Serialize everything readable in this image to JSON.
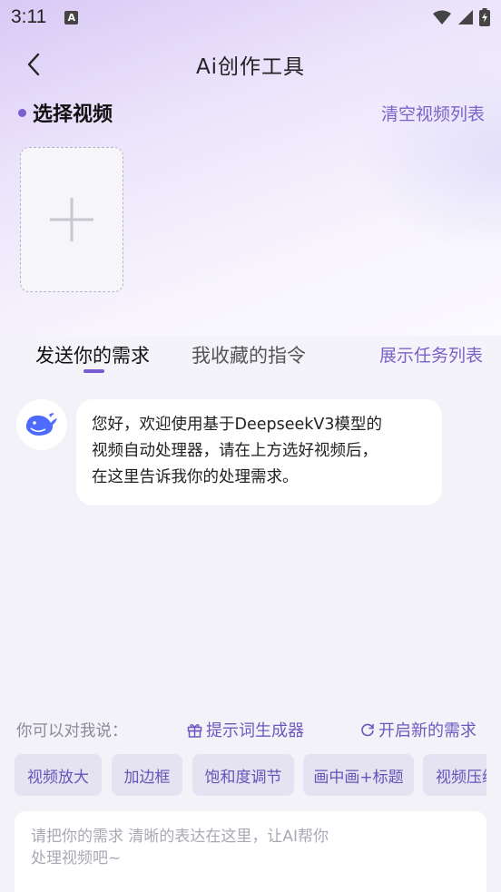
{
  "status": {
    "time": "3:11",
    "app_badge": "A"
  },
  "nav": {
    "title": "Ai创作工具"
  },
  "select": {
    "title": "选择视频",
    "clear": "清空视频列表"
  },
  "tabs": {
    "send": "发送你的需求",
    "favorites": "我收藏的指令",
    "tasks": "展示任务列表"
  },
  "chat": {
    "lines": [
      "您好，欢迎使用基于DeepseekV3模型的",
      "视频自动处理器，请在上方选好视频后，",
      "在这里告诉我你的处理需求。"
    ]
  },
  "suggest": {
    "label": "你可以对我说：",
    "prompt_gen": "提示词生成器",
    "new_request": "开启新的需求"
  },
  "chips": [
    "视频放大",
    "加边框",
    "饱和度调节",
    "画中画+标题",
    "视频压缩"
  ],
  "input": {
    "placeholder": "请把你的需求 清晰的表达在这里，让AI帮你处理视频吧~"
  },
  "colors": {
    "accent": "#7a63c8",
    "indicator": "#7a5bd1",
    "chip_bg": "#e5e2f2"
  },
  "icons": [
    "back-arrow-icon",
    "plus-icon",
    "deepseek-whale-icon",
    "gift-icon",
    "refresh-icon",
    "wifi-icon",
    "signal-icon",
    "battery-icon"
  ]
}
